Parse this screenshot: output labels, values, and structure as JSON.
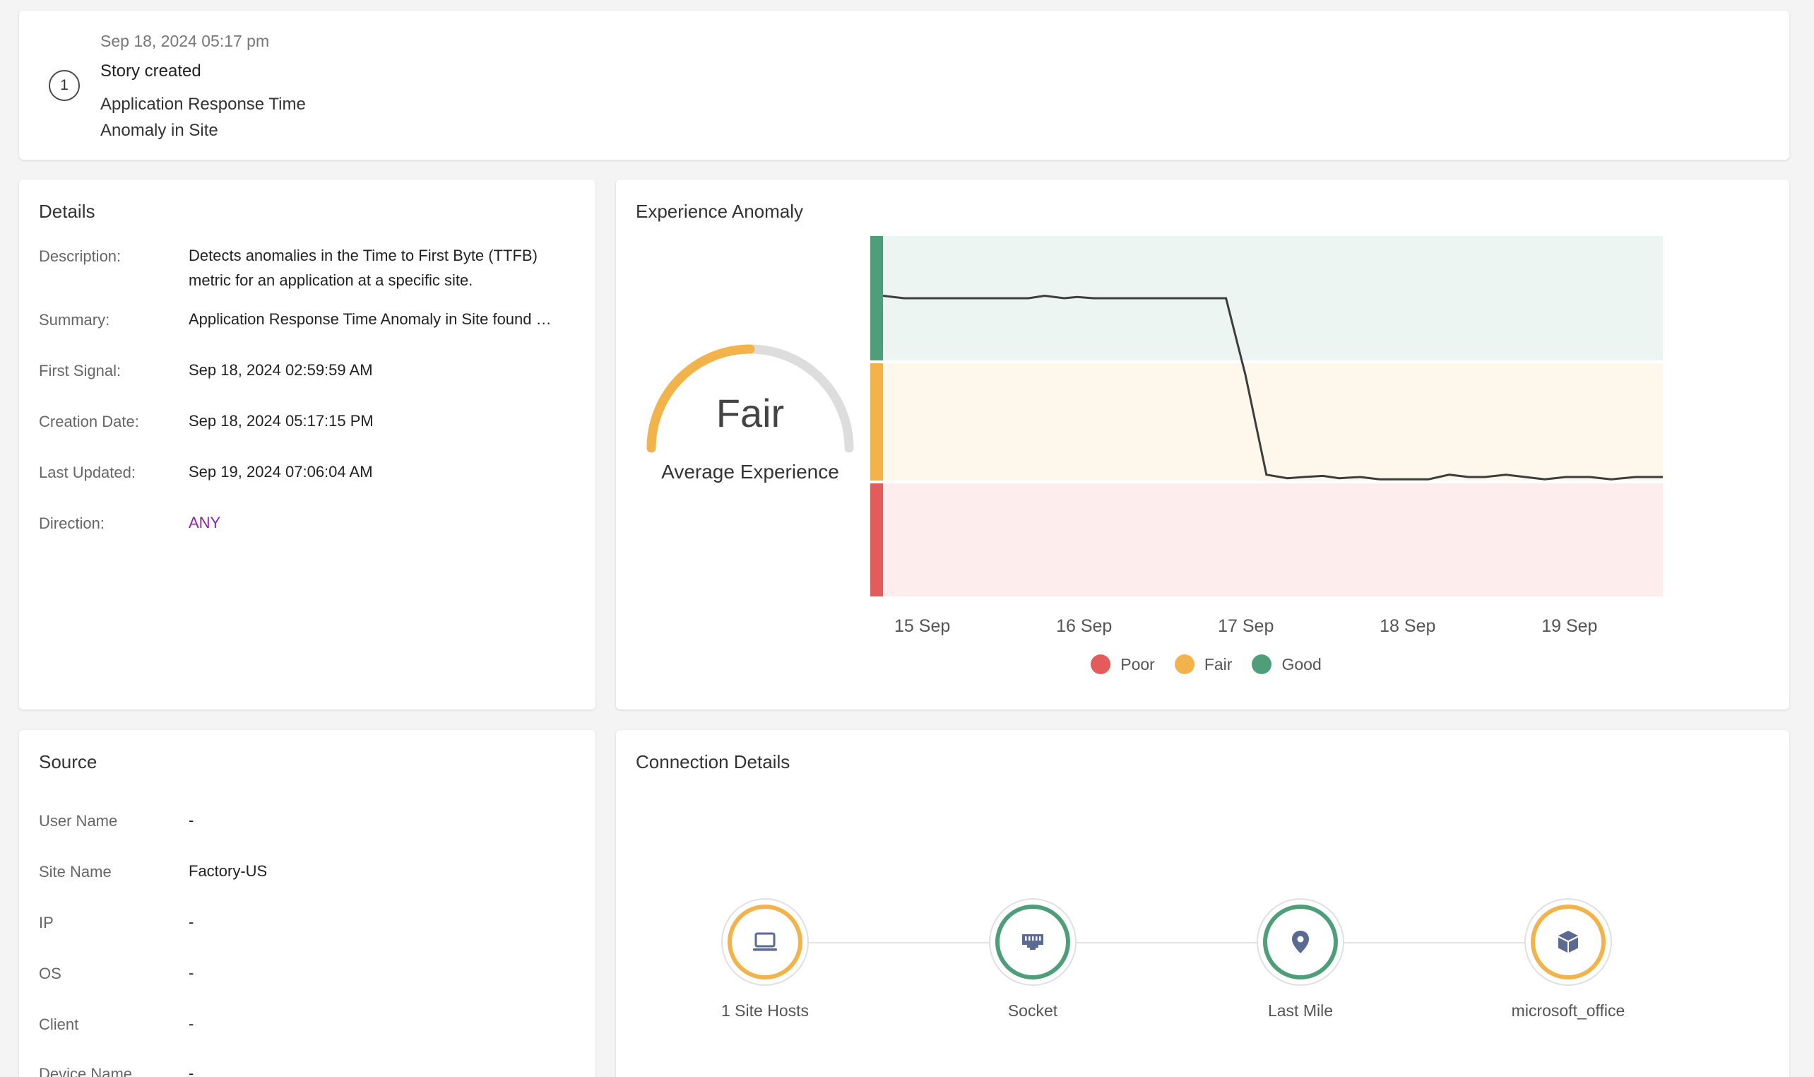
{
  "timeline": {
    "step": "1",
    "date": "Sep 18, 2024 05:17 pm",
    "title": "Story created",
    "subtitle": "Application Response Time Anomaly in Site"
  },
  "details": {
    "title": "Details",
    "rows": [
      {
        "label": "Description:",
        "value": "Detects anomalies in the Time to First Byte (TTFB) metric for an application at a specific site."
      },
      {
        "label": "Summary:",
        "value": "Application Response Time Anomaly in Site found …"
      },
      {
        "label": "First Signal:",
        "value": "Sep 18, 2024 02:59:59 AM"
      },
      {
        "label": "Creation Date:",
        "value": "Sep 18, 2024 05:17:15 PM"
      },
      {
        "label": "Last Updated:",
        "value": "Sep 19, 2024 07:06:04 AM"
      },
      {
        "label": "Direction:",
        "value": "ANY"
      }
    ]
  },
  "anomaly": {
    "title": "Experience Anomaly",
    "gauge_value": "Fair",
    "gauge_caption": "Average Experience",
    "gauge_fill_fraction": 0.5
  },
  "colors": {
    "poor": "#e35b5b",
    "fair": "#f2b34a",
    "good": "#4e9e7a",
    "poor_band": "#fdeeed",
    "fair_band": "#fef8ec",
    "good_band": "#ecf5f1",
    "accent": "#8e24aa",
    "node_icon": "#5a6a92"
  },
  "chart_data": {
    "type": "line",
    "x_tick_labels": [
      "15 Sep",
      "16 Sep",
      "17 Sep",
      "18 Sep",
      "19 Sep"
    ],
    "x_tick_days": [
      15,
      16,
      17,
      18,
      19
    ],
    "x_range": [
      14.93,
      19.75
    ],
    "y_categories": [
      "Poor",
      "Fair",
      "Good"
    ],
    "y_range": [
      0,
      3
    ],
    "legend": [
      "Poor",
      "Fair",
      "Good"
    ],
    "legend_position": "bottom",
    "points": [
      [
        14.93,
        2.52
      ],
      [
        15.06,
        2.5
      ],
      [
        15.2,
        2.5
      ],
      [
        15.35,
        2.5
      ],
      [
        15.5,
        2.5
      ],
      [
        15.7,
        2.5
      ],
      [
        15.83,
        2.5
      ],
      [
        15.93,
        2.52
      ],
      [
        16.05,
        2.5
      ],
      [
        16.13,
        2.51
      ],
      [
        16.23,
        2.5
      ],
      [
        16.43,
        2.5
      ],
      [
        16.63,
        2.5
      ],
      [
        16.83,
        2.5
      ],
      [
        17.05,
        2.5
      ],
      [
        17.17,
        1.9
      ],
      [
        17.3,
        1.05
      ],
      [
        17.43,
        1.02
      ],
      [
        17.53,
        1.03
      ],
      [
        17.65,
        1.04
      ],
      [
        17.75,
        1.02
      ],
      [
        17.88,
        1.03
      ],
      [
        18.0,
        1.01
      ],
      [
        18.13,
        1.01
      ],
      [
        18.3,
        1.01
      ],
      [
        18.43,
        1.05
      ],
      [
        18.55,
        1.03
      ],
      [
        18.65,
        1.03
      ],
      [
        18.78,
        1.05
      ],
      [
        18.9,
        1.03
      ],
      [
        19.02,
        1.01
      ],
      [
        19.15,
        1.03
      ],
      [
        19.3,
        1.03
      ],
      [
        19.43,
        1.01
      ],
      [
        19.58,
        1.03
      ],
      [
        19.75,
        1.03
      ]
    ]
  },
  "source": {
    "title": "Source",
    "rows": [
      {
        "label": "User Name",
        "value": "-"
      },
      {
        "label": "Site Name",
        "value": "Factory-US"
      },
      {
        "label": "IP",
        "value": "-"
      },
      {
        "label": "OS",
        "value": "-"
      },
      {
        "label": "Client",
        "value": "-"
      },
      {
        "label": "Device Name",
        "value": "-"
      }
    ]
  },
  "connection": {
    "title": "Connection Details",
    "nodes": [
      {
        "label": "1 Site Hosts",
        "icon": "laptop-icon",
        "status": "fair"
      },
      {
        "label": "Socket",
        "icon": "ethernet-port-icon",
        "status": "good"
      },
      {
        "label": "Last Mile",
        "icon": "location-pin-icon",
        "status": "good"
      },
      {
        "label": "microsoft_office",
        "icon": "cube-icon",
        "status": "fair"
      }
    ]
  }
}
